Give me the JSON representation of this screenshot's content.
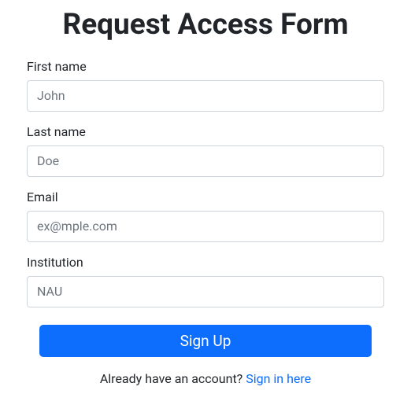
{
  "title": "Request Access Form",
  "fields": {
    "first_name": {
      "label": "First name",
      "placeholder": "John",
      "value": ""
    },
    "last_name": {
      "label": "Last name",
      "placeholder": "Doe",
      "value": ""
    },
    "email": {
      "label": "Email",
      "placeholder": "ex@mple.com",
      "value": ""
    },
    "institution": {
      "label": "Institution",
      "placeholder": "NAU",
      "value": ""
    }
  },
  "submit_label": "Sign Up",
  "signin": {
    "prompt": "Already have an account? ",
    "link_text": "Sign in here"
  }
}
